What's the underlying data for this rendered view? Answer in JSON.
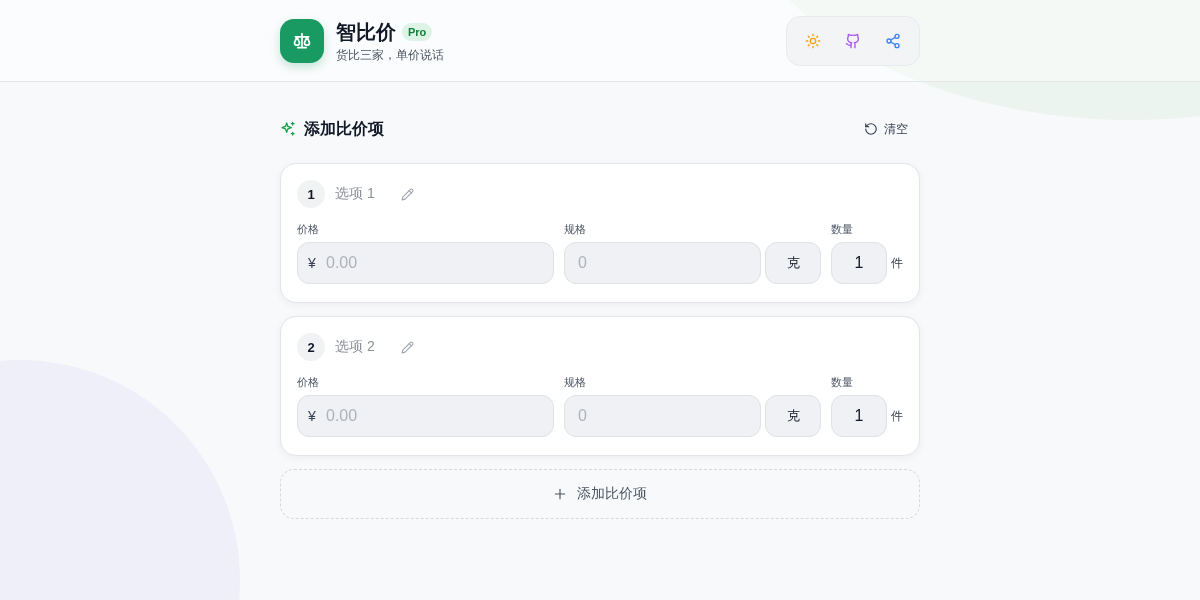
{
  "header": {
    "app_name": "智比价",
    "badge": "Pro",
    "tagline": "货比三家，单价说话",
    "actions": [
      {
        "kind": "theme"
      },
      {
        "kind": "github"
      },
      {
        "kind": "share"
      }
    ]
  },
  "section": {
    "title": "添加比价项",
    "clear_button": "清空"
  },
  "items": [
    {
      "index": "1",
      "name": "选项 1",
      "price_label": "价格",
      "currency": "¥",
      "price_placeholder": "0.00",
      "spec_label": "规格",
      "spec_placeholder": "0",
      "unit": "克",
      "quantity_label": "数量",
      "quantity": "1",
      "quantity_unit": "件"
    },
    {
      "index": "2",
      "name": "选项 2",
      "price_label": "价格",
      "currency": "¥",
      "price_placeholder": "0.00",
      "spec_label": "规格",
      "spec_placeholder": "0",
      "unit": "克",
      "quantity_label": "数量",
      "quantity": "1",
      "quantity_unit": "件"
    }
  ],
  "add_button": "添加比价项"
}
